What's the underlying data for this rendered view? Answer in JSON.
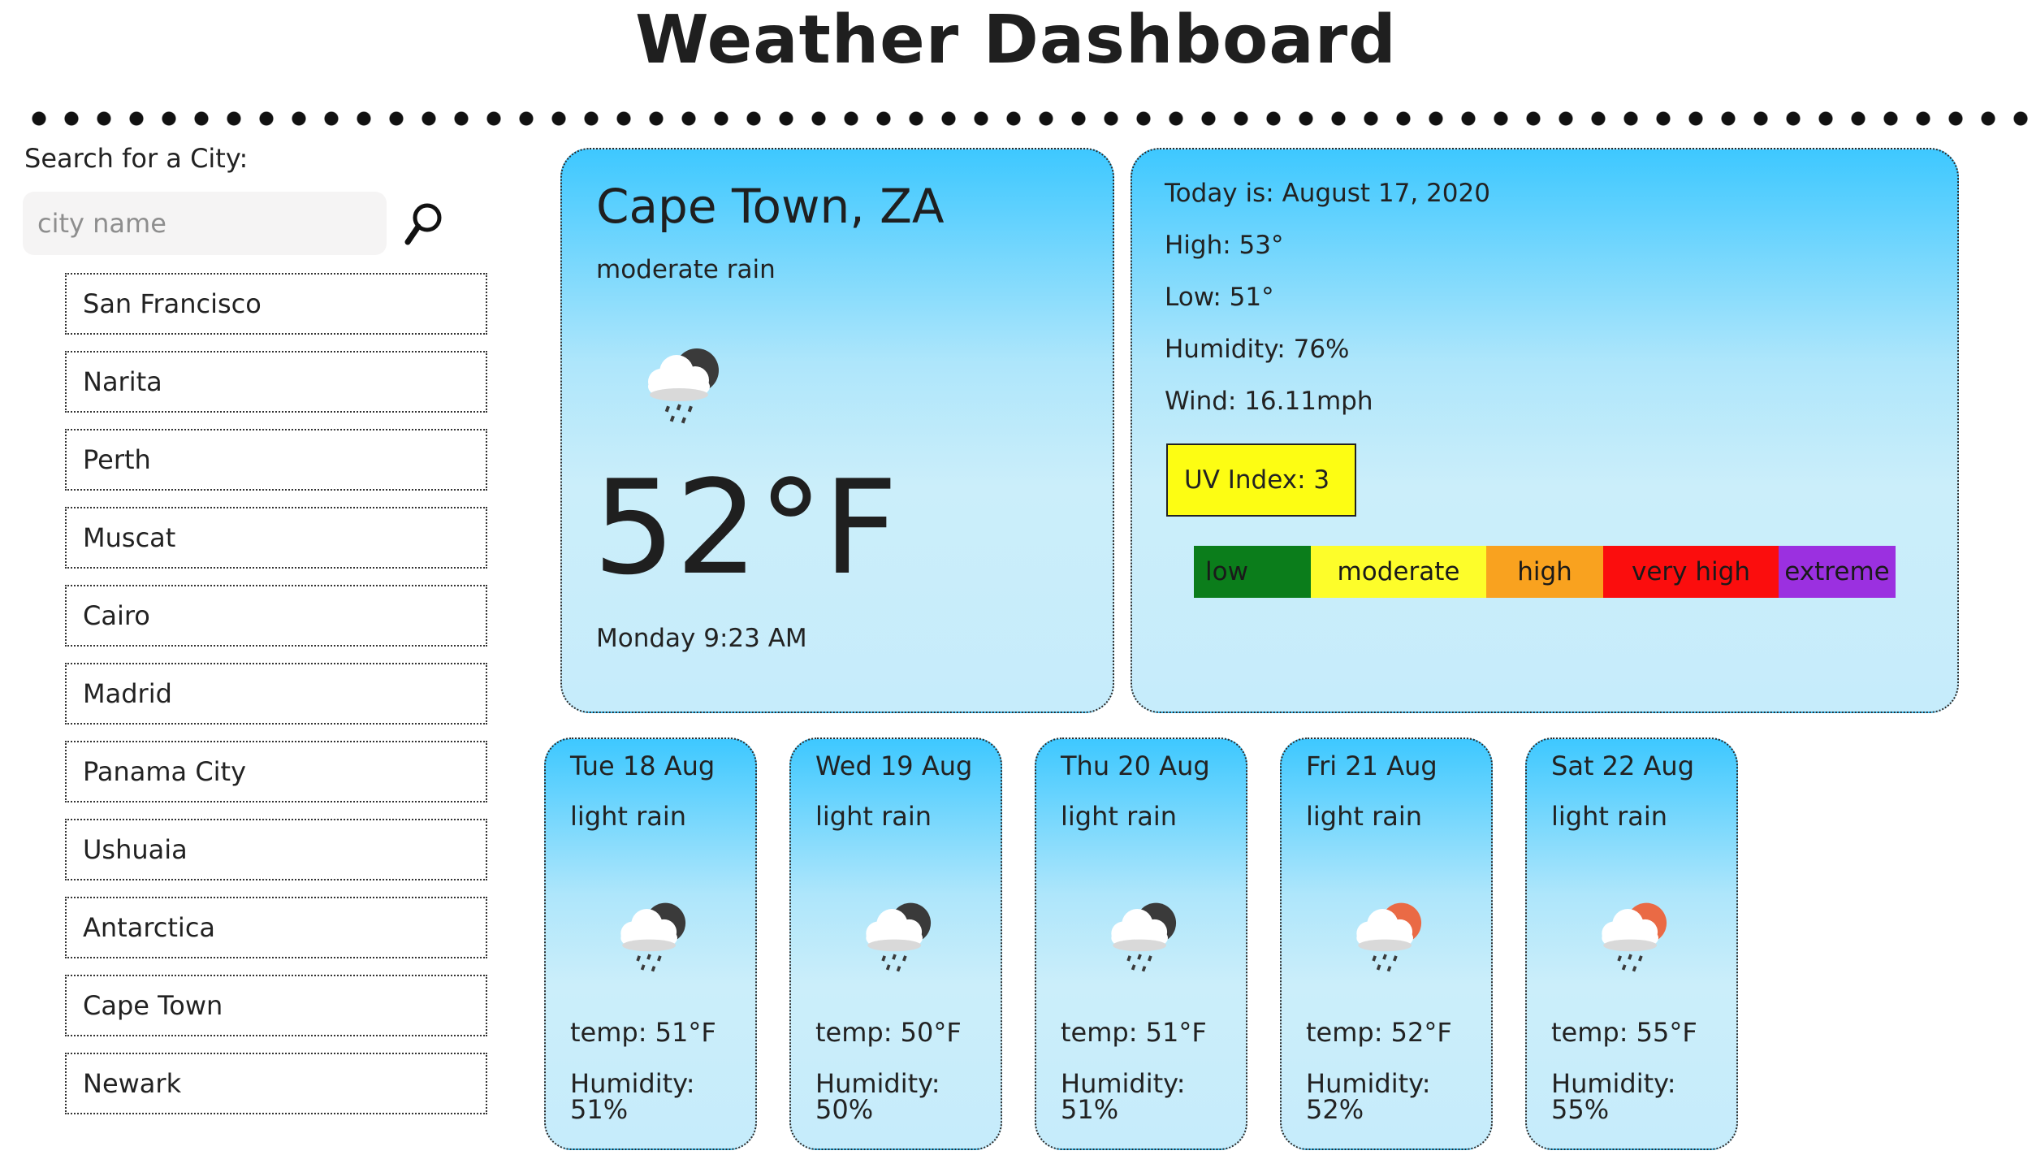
{
  "header": {
    "title": "Weather Dashboard"
  },
  "sidebar": {
    "search_label": "Search for a City:",
    "search_placeholder": "city name",
    "cities": [
      "San Francisco",
      "Narita",
      "Perth",
      "Muscat",
      "Cairo",
      "Madrid",
      "Panama City",
      "Ushuaia",
      "Antarctica",
      "Cape Town",
      "Newark"
    ]
  },
  "current": {
    "city": "Cape Town, ZA",
    "condition": "moderate rain",
    "icon": "rain-night-icon",
    "temperature": "52°F",
    "datetime": "Monday 9:23 AM"
  },
  "details": {
    "today": "Today is: August 17, 2020",
    "high": "High: 53°",
    "low": "Low: 51°",
    "humidity": "Humidity: 76%",
    "wind": "Wind: 16.11mph",
    "uv_index": "UV Index: 3",
    "uv_color": "#fdfd13"
  },
  "uv_scale": [
    {
      "label": "low",
      "color": "#0b7d1b"
    },
    {
      "label": "moderate",
      "color": "#fdfd2a"
    },
    {
      "label": "high",
      "color": "#f9a21f"
    },
    {
      "label": "very high",
      "color": "#fb0d0d"
    },
    {
      "label": "extreme",
      "color": "#9b30e0"
    }
  ],
  "forecast": [
    {
      "date": "Tue 18 Aug",
      "condition": "light rain",
      "icon": "rain-night-icon",
      "temp": "temp: 51°F",
      "humidity": "Humidity: 51%"
    },
    {
      "date": "Wed 19 Aug",
      "condition": "light rain",
      "icon": "rain-night-icon",
      "temp": "temp: 50°F",
      "humidity": "Humidity: 50%"
    },
    {
      "date": "Thu 20 Aug",
      "condition": "light rain",
      "icon": "rain-night-icon",
      "temp": "temp: 51°F",
      "humidity": "Humidity: 51%"
    },
    {
      "date": "Fri 21 Aug",
      "condition": "light rain",
      "icon": "rain-day-icon",
      "temp": "temp: 52°F",
      "humidity": "Humidity: 52%"
    },
    {
      "date": "Sat 22 Aug",
      "condition": "light rain",
      "icon": "rain-day-icon",
      "temp": "temp: 55°F",
      "humidity": "Humidity: 55%"
    }
  ],
  "colors": {
    "card_gradient_top": "#3ec8ff",
    "card_gradient_bottom": "#c6ecfb",
    "moon": "#3a3a3a",
    "sun": "#ea6a45"
  }
}
